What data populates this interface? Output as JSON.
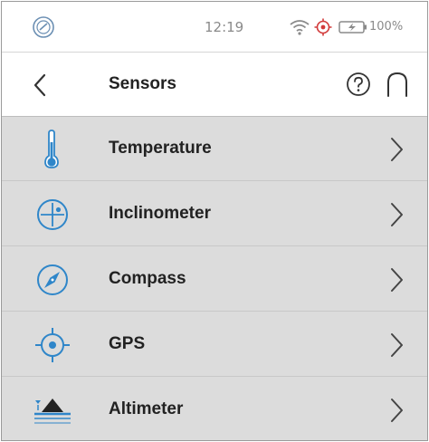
{
  "status": {
    "time": "12:19",
    "battery_percent": "100%",
    "icons": [
      "app-logo-icon",
      "wifi-icon",
      "gps-target-icon",
      "battery-charging-icon"
    ]
  },
  "header": {
    "title": "Sensors",
    "icons": [
      "back-chevron-icon",
      "help-icon",
      "home-icon"
    ]
  },
  "sensors": [
    {
      "label": "Temperature",
      "icon": "thermometer-icon"
    },
    {
      "label": "Inclinometer",
      "icon": "inclinometer-icon"
    },
    {
      "label": "Compass",
      "icon": "compass-icon"
    },
    {
      "label": "GPS",
      "icon": "gps-icon"
    },
    {
      "label": "Altimeter",
      "icon": "altimeter-icon"
    }
  ],
  "colors": {
    "accent": "#2f86c9",
    "list_background": "#dcdcdc",
    "status_red": "#d23a3a"
  }
}
